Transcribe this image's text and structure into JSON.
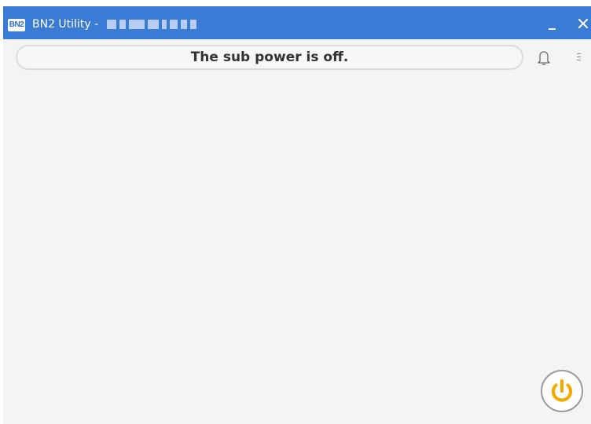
{
  "window": {
    "title": "BN2 Utility -",
    "logo_text": "BN2"
  },
  "status": {
    "message": "The sub power is off."
  },
  "icons": {
    "app_logo": "bn2-logo-icon",
    "minimize": "minimize-icon",
    "close": "close-icon",
    "notifications": "bell-icon",
    "menu": "menu-icon",
    "power": "power-icon"
  },
  "colors": {
    "titlebar": "#3a7bd5",
    "background": "#f4f4f4",
    "power_accent": "#f5a800"
  }
}
